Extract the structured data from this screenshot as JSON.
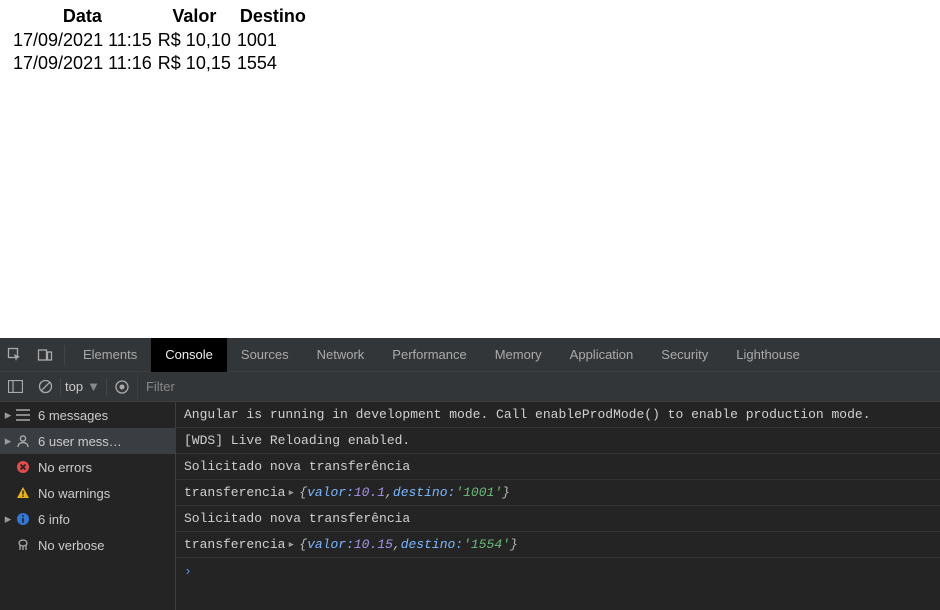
{
  "table": {
    "headers": {
      "data": "Data",
      "valor": "Valor",
      "destino": "Destino"
    },
    "rows": [
      {
        "data": "17/09/2021 11:15",
        "valor": "R$ 10,10",
        "destino": "1001"
      },
      {
        "data": "17/09/2021 11:16",
        "valor": "R$ 10,15",
        "destino": "1554"
      }
    ]
  },
  "devtools": {
    "tabs": {
      "elements": "Elements",
      "console": "Console",
      "sources": "Sources",
      "network": "Network",
      "performance": "Performance",
      "memory": "Memory",
      "application": "Application",
      "security": "Security",
      "lighthouse": "Lighthouse"
    },
    "toolbar": {
      "context": "top",
      "filter_placeholder": "Filter"
    },
    "sidebar": {
      "messages": "6 messages",
      "user": "6 user mess…",
      "errors": "No errors",
      "warnings": "No warnings",
      "info": "6 info",
      "verbose": "No verbose"
    },
    "log": [
      {
        "kind": "text",
        "text": "Angular is running in development mode. Call enableProdMode() to enable production mode."
      },
      {
        "kind": "text",
        "text": "[WDS] Live Reloading enabled."
      },
      {
        "kind": "text",
        "text": "Solicitado nova transferência"
      },
      {
        "kind": "obj",
        "label": "transferencia",
        "valor": "10.1",
        "destino": "'1001'"
      },
      {
        "kind": "text",
        "text": "Solicitado nova transferência"
      },
      {
        "kind": "obj",
        "label": "transferencia",
        "valor": "10.15",
        "destino": "'1554'"
      }
    ]
  }
}
